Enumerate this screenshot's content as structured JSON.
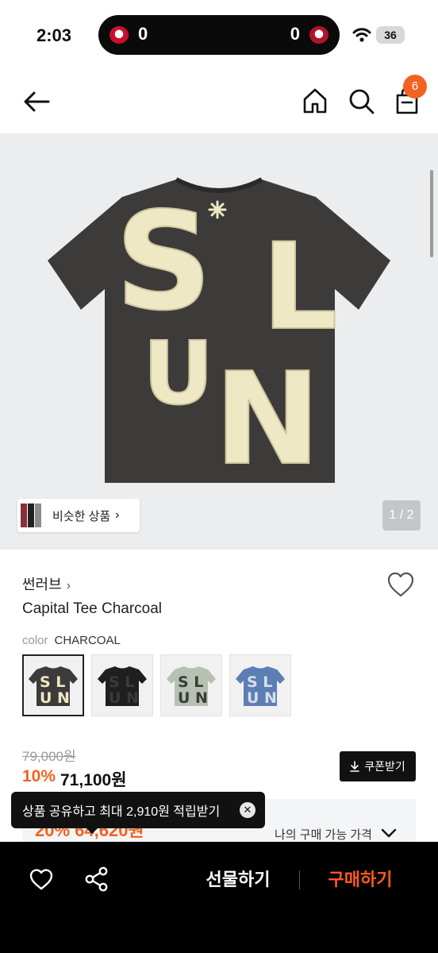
{
  "status_bar": {
    "time": "2:03",
    "score_left": "0",
    "score_right": "0",
    "battery": "36"
  },
  "header": {
    "cart_count": "6"
  },
  "hero": {
    "graphic_text": [
      "S",
      "L",
      "U",
      "N"
    ],
    "similar_label": "비슷한 상품",
    "page_indicator": "1 / 2"
  },
  "product": {
    "brand": "썬러브",
    "brand_chevron": "›",
    "title": "Capital Tee Charcoal",
    "color_label": "color",
    "color_value": "CHARCOAL",
    "swatches": [
      {
        "name": "charcoal",
        "shirt": "#3d3b3a",
        "letters": "#eee8c4"
      },
      {
        "name": "black",
        "shirt": "#1f1f1f",
        "letters": "#3a3a3a"
      },
      {
        "name": "sage",
        "shirt": "#b7c1b2",
        "letters": "#3a3a3a"
      },
      {
        "name": "blue",
        "shirt": "#5d7db5",
        "letters": "#d8dfe8"
      }
    ],
    "original_price": "79,000원",
    "discount": "10%",
    "sale_price": "71,100원",
    "coupon_label": "쿠폰받기"
  },
  "my_price": {
    "label": "나의 구매 가능 가격",
    "hidden_value": "20% 64,620원"
  },
  "toast": {
    "message": "상품 공유하고 최대 2,910원 적립받기"
  },
  "bottom_bar": {
    "gift_label": "선물하기",
    "buy_label": "구매하기"
  },
  "colors": {
    "accent": "#f26322",
    "buy": "#ff5a1f",
    "shirt": "#3d3b3a",
    "letters": "#eee8c4"
  }
}
